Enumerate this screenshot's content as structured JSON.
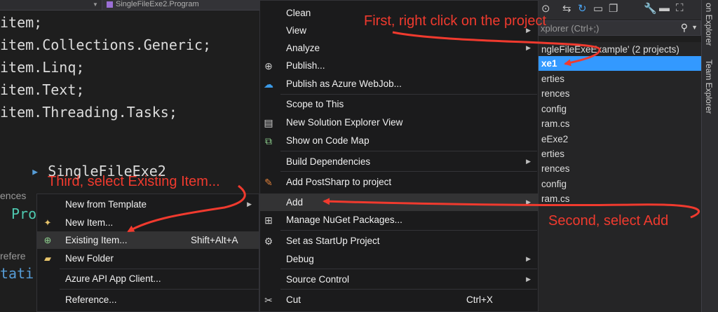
{
  "editor": {
    "nav_dropdown": "SingleFileExe2.Program",
    "code_lines": [
      "item;",
      "item.Collections.Generic;",
      "item.Linq;",
      "item.Text;",
      "item.Threading.Tasks;"
    ],
    "namespace_line": "SingleFileExe2",
    "references_1": "ences",
    "pro_fragment": "Pro",
    "references_2": "refere",
    "static_fragment": "tati"
  },
  "solution_explorer": {
    "search_placeholder": "xplorer (Ctrl+;)",
    "tree": [
      "ngleFileExeExample' (2 projects)",
      "xe1",
      "erties",
      "rences",
      "config",
      "ram.cs",
      "eExe2",
      "erties",
      "rences",
      "config",
      "ram.cs"
    ],
    "side_tabs": [
      "on Explorer",
      "Team Explorer"
    ]
  },
  "context_menu": {
    "items": [
      {
        "label": "Clean",
        "icon": "",
        "arrow": false
      },
      {
        "label": "View",
        "icon": "",
        "arrow": true
      },
      {
        "label": "Analyze",
        "icon": "",
        "arrow": true
      },
      {
        "label": "Publish...",
        "icon": "globe-icon",
        "arrow": false
      },
      {
        "label": "Publish as Azure WebJob...",
        "icon": "azure-cloud-icon",
        "arrow": false
      },
      {
        "label": "Scope to This",
        "icon": "",
        "arrow": false
      },
      {
        "label": "New Solution Explorer View",
        "icon": "new-view-icon",
        "arrow": false
      },
      {
        "label": "Show on Code Map",
        "icon": "code-map-icon",
        "arrow": false
      },
      {
        "label": "Build Dependencies",
        "icon": "",
        "arrow": true
      },
      {
        "label": "Add PostSharp to project",
        "icon": "postsharp-icon",
        "arrow": false
      },
      {
        "label": "Add",
        "icon": "",
        "arrow": true
      },
      {
        "label": "Manage NuGet Packages...",
        "icon": "nuget-icon",
        "arrow": false
      },
      {
        "label": "Set as StartUp Project",
        "icon": "gear-icon",
        "arrow": false
      },
      {
        "label": "Debug",
        "icon": "",
        "arrow": true
      },
      {
        "label": "Source Control",
        "icon": "",
        "arrow": true
      },
      {
        "label": "Cut",
        "icon": "scissors-icon",
        "shortcut": "Ctrl+X",
        "arrow": false
      }
    ]
  },
  "add_submenu": {
    "items": [
      {
        "label": "New from Template",
        "icon": "",
        "arrow": true
      },
      {
        "label": "New Item...",
        "icon": "new-item-icon",
        "arrow": false
      },
      {
        "label": "Existing Item...",
        "icon": "existing-item-icon",
        "shortcut": "Shift+Alt+A",
        "arrow": false
      },
      {
        "label": "New Folder",
        "icon": "folder-icon",
        "arrow": false
      },
      {
        "label": "Azure API App Client...",
        "icon": "",
        "arrow": false
      },
      {
        "label": "Reference...",
        "icon": "",
        "arrow": false
      }
    ]
  },
  "annotations": {
    "first": "First, right click on the project",
    "second": "Second, select Add",
    "third": "Third, select Existing Item..."
  },
  "colors": {
    "annotation_red": "#f03a2e",
    "selection_blue": "#3399ff",
    "menu_bg": "#1b1b1c"
  }
}
